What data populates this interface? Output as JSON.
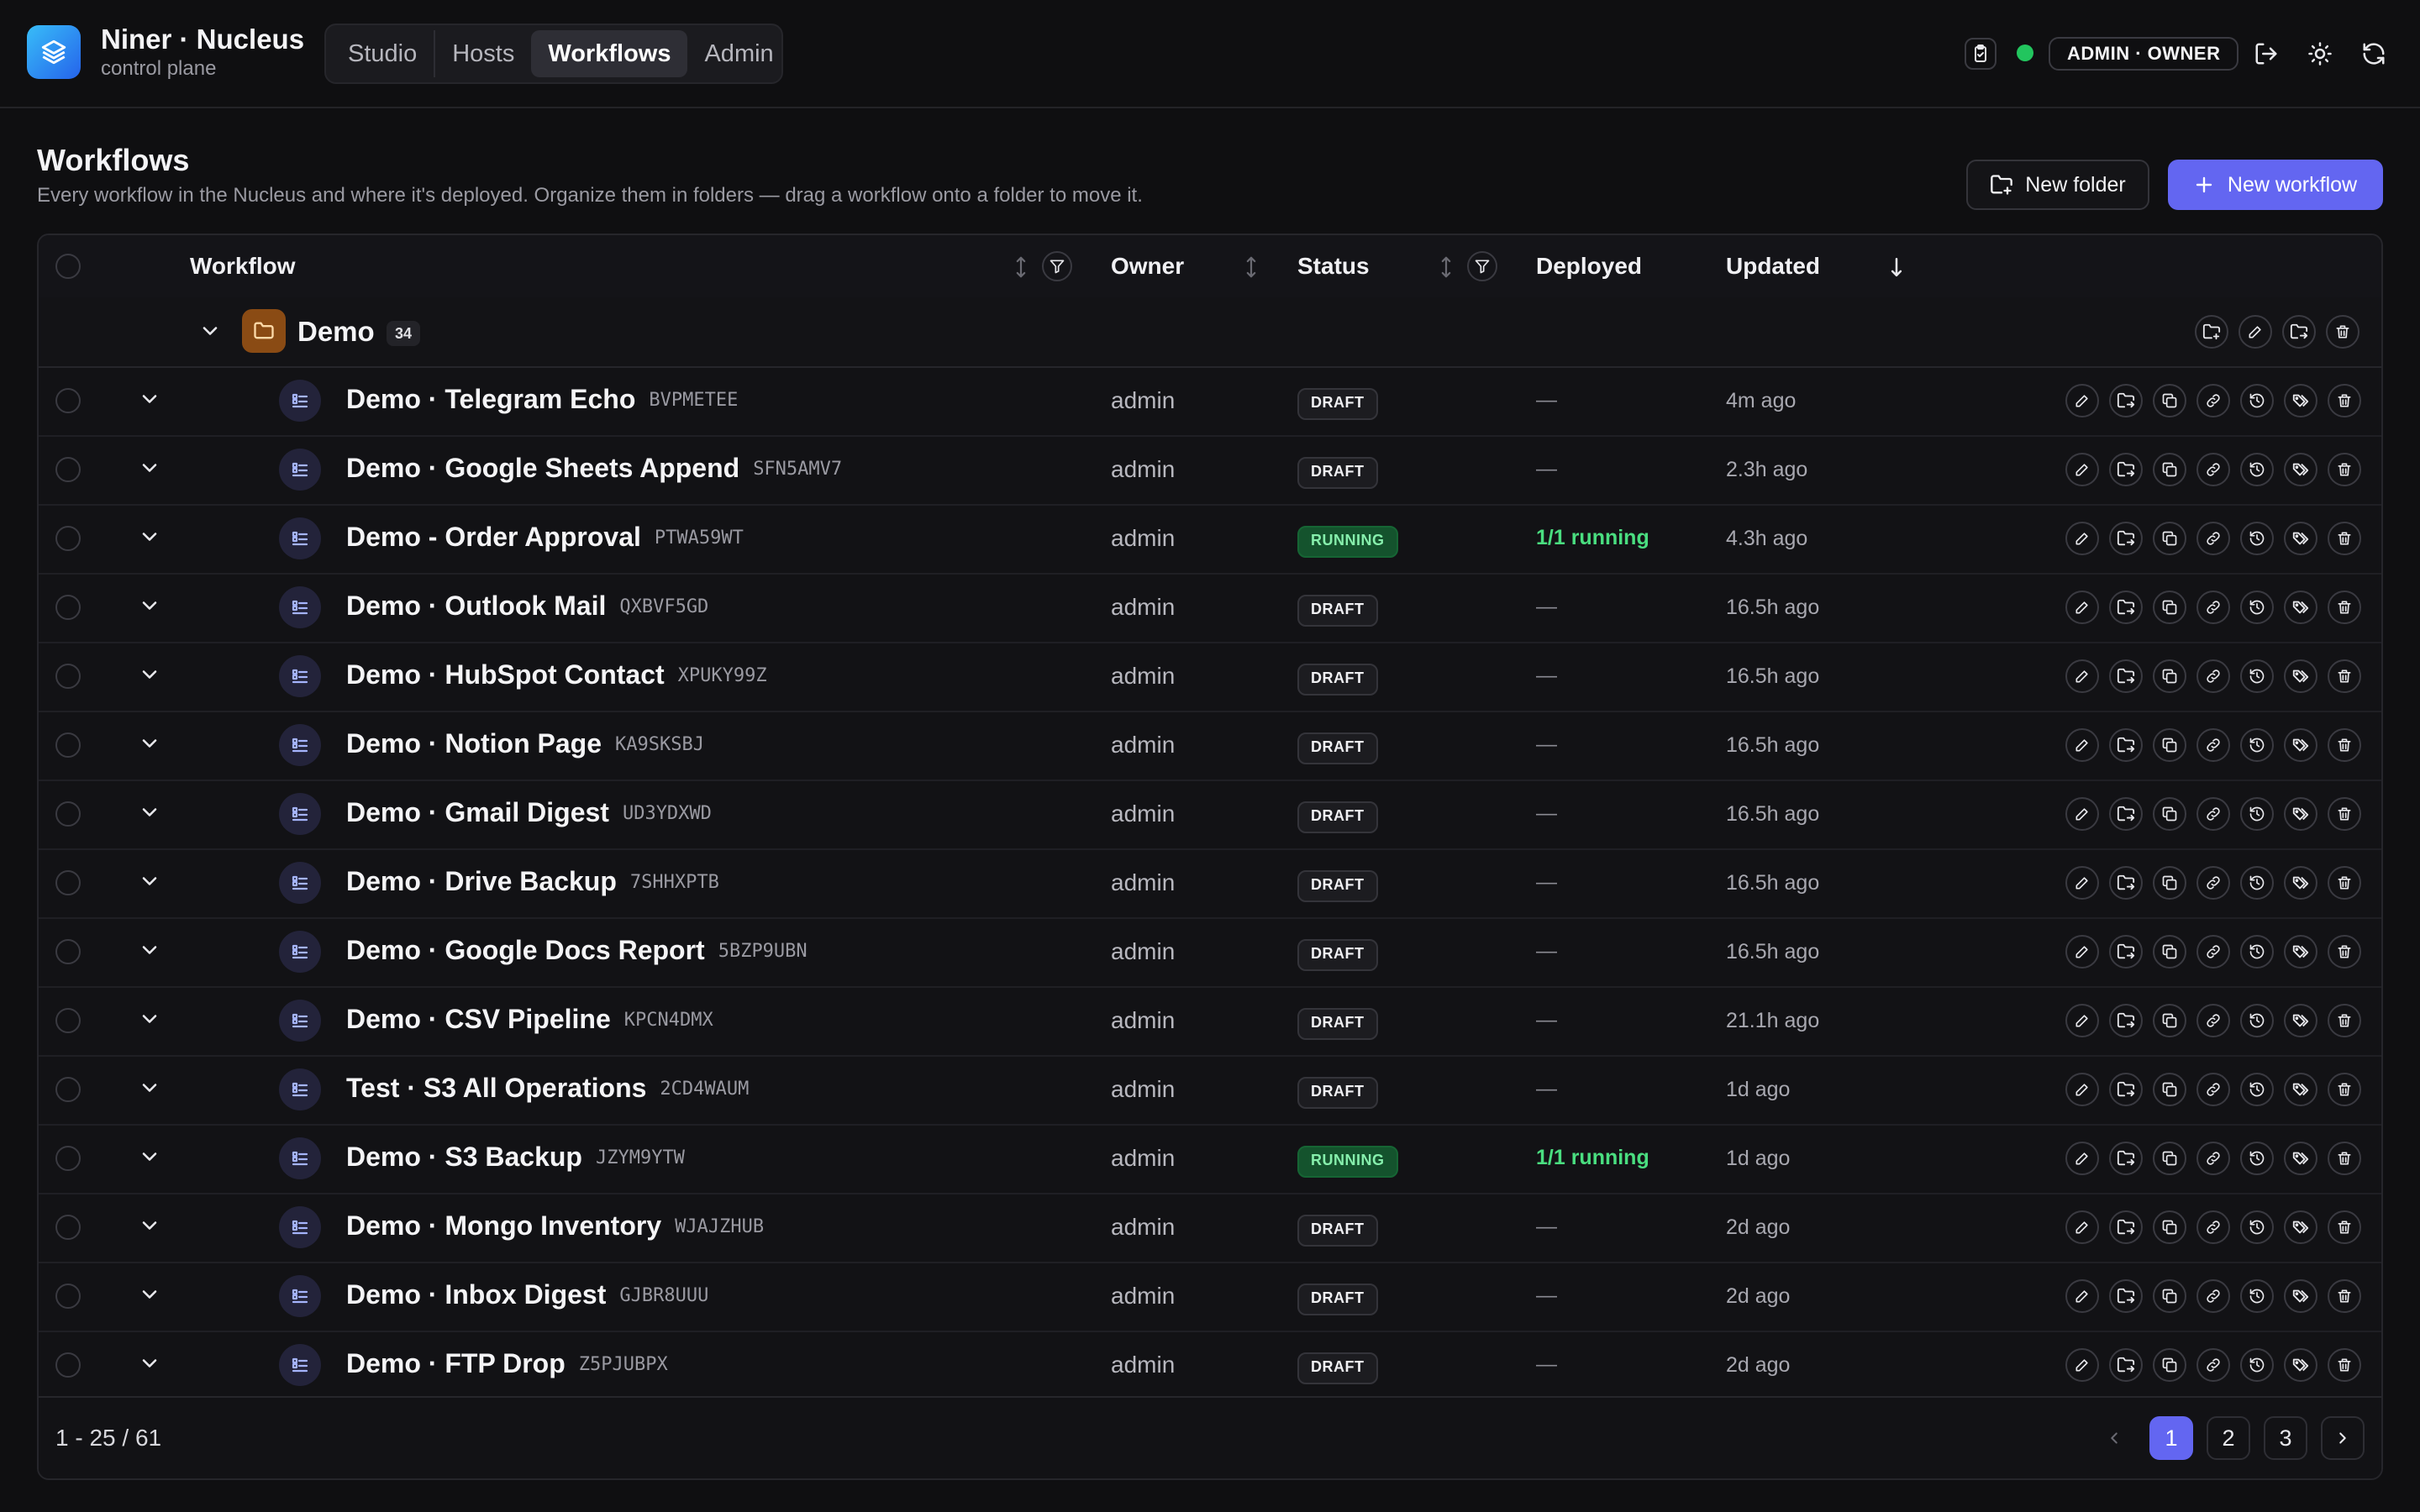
{
  "app": {
    "title": "Niner · Nucleus",
    "subtitle": "control plane",
    "role_label": "ADMIN · OWNER"
  },
  "nav": [
    {
      "label": "Studio",
      "active": false
    },
    {
      "label": "Hosts",
      "active": false
    },
    {
      "label": "Workflows",
      "active": true
    },
    {
      "label": "Admin",
      "active": false
    }
  ],
  "page": {
    "title": "Workflows",
    "description": "Every workflow in the Nucleus and where it's deployed. Organize them in folders — drag a workflow onto a folder to move it.",
    "new_folder_label": "New folder",
    "new_workflow_label": "New workflow"
  },
  "columns": {
    "workflow": "Workflow",
    "owner": "Owner",
    "status": "Status",
    "deployed": "Deployed",
    "updated": "Updated"
  },
  "folder": {
    "name": "Demo",
    "count": "34"
  },
  "rows": [
    {
      "name": "Demo · Telegram Echo",
      "code": "BVPMETEE",
      "owner": "admin",
      "status": "DRAFT",
      "deployed": "—",
      "updated": "4m ago"
    },
    {
      "name": "Demo · Google Sheets Append",
      "code": "SFN5AMV7",
      "owner": "admin",
      "status": "DRAFT",
      "deployed": "—",
      "updated": "2.3h ago"
    },
    {
      "name": "Demo - Order Approval",
      "code": "PTWA59WT",
      "owner": "admin",
      "status": "RUNNING",
      "deployed": "1/1 running",
      "updated": "4.3h ago"
    },
    {
      "name": "Demo · Outlook Mail",
      "code": "QXBVF5GD",
      "owner": "admin",
      "status": "DRAFT",
      "deployed": "—",
      "updated": "16.5h ago"
    },
    {
      "name": "Demo · HubSpot Contact",
      "code": "XPUKY99Z",
      "owner": "admin",
      "status": "DRAFT",
      "deployed": "—",
      "updated": "16.5h ago"
    },
    {
      "name": "Demo · Notion Page",
      "code": "KA9SKSBJ",
      "owner": "admin",
      "status": "DRAFT",
      "deployed": "—",
      "updated": "16.5h ago"
    },
    {
      "name": "Demo · Gmail Digest",
      "code": "UD3YDXWD",
      "owner": "admin",
      "status": "DRAFT",
      "deployed": "—",
      "updated": "16.5h ago"
    },
    {
      "name": "Demo · Drive Backup",
      "code": "7SHHXPTB",
      "owner": "admin",
      "status": "DRAFT",
      "deployed": "—",
      "updated": "16.5h ago"
    },
    {
      "name": "Demo · Google Docs Report",
      "code": "5BZP9UBN",
      "owner": "admin",
      "status": "DRAFT",
      "deployed": "—",
      "updated": "16.5h ago"
    },
    {
      "name": "Demo · CSV Pipeline",
      "code": "KPCN4DMX",
      "owner": "admin",
      "status": "DRAFT",
      "deployed": "—",
      "updated": "21.1h ago"
    },
    {
      "name": "Test · S3 All Operations",
      "code": "2CD4WAUM",
      "owner": "admin",
      "status": "DRAFT",
      "deployed": "—",
      "updated": "1d ago"
    },
    {
      "name": "Demo · S3 Backup",
      "code": "JZYM9YTW",
      "owner": "admin",
      "status": "RUNNING",
      "deployed": "1/1 running",
      "updated": "1d ago"
    },
    {
      "name": "Demo · Mongo Inventory",
      "code": "WJAJZHUB",
      "owner": "admin",
      "status": "DRAFT",
      "deployed": "—",
      "updated": "2d ago"
    },
    {
      "name": "Demo · Inbox Digest",
      "code": "GJBR8UUU",
      "owner": "admin",
      "status": "DRAFT",
      "deployed": "—",
      "updated": "2d ago"
    },
    {
      "name": "Demo · FTP Drop",
      "code": "Z5PJUBPX",
      "owner": "admin",
      "status": "DRAFT",
      "deployed": "—",
      "updated": "2d ago"
    }
  ],
  "pagination": {
    "range": "1 - 25 / 61",
    "pages": [
      "1",
      "2",
      "3"
    ],
    "current": "1"
  },
  "colors": {
    "accent": "#6366f1",
    "online": "#22c55e",
    "running_text": "#4ade80",
    "folder": "#8a4b14"
  }
}
